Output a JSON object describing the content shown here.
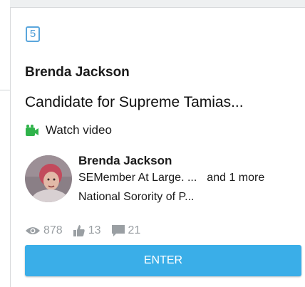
{
  "card": {
    "number": "5",
    "author_name_top": "Brenda Jackson",
    "headline": "Candidate for Supreme Tamias...",
    "watch_label": "Watch video",
    "author": {
      "name": "Brenda Jackson",
      "line1": "SEMember At Large. ...",
      "more": "and 1 more",
      "line2": "National Sorority of P..."
    },
    "stats": {
      "views": "878",
      "likes": "13",
      "comments": "21"
    },
    "enter_label": "ENTER"
  },
  "colors": {
    "accent": "#3aaee8",
    "badge": "#5aa6dc",
    "video_icon": "#2fb34a",
    "stat_gray": "#9a9fa3"
  },
  "icons": [
    "video-camera-icon",
    "eye-icon",
    "thumbs-up-icon",
    "comment-icon"
  ]
}
